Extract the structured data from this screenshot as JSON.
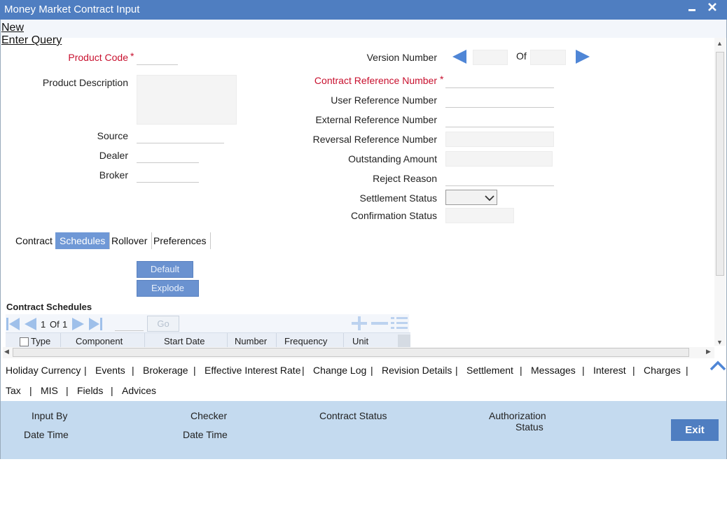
{
  "window": {
    "title": "Money Market Contract Input",
    "minimize_label": "▬",
    "close_label": "✕"
  },
  "toolbar": {
    "new_label": "New",
    "enter_query_label": "Enter Query"
  },
  "form_left": {
    "product_code_label": "Product Code",
    "product_description_label": "Product Description",
    "source_label": "Source",
    "dealer_label": "Dealer",
    "broker_label": "Broker"
  },
  "form_right": {
    "version_number_label": "Version Number",
    "of_label": "Of",
    "contract_reference_label": "Contract Reference Number",
    "user_reference_label": "User Reference Number",
    "external_reference_label": "External Reference Number",
    "reversal_reference_label": "Reversal Reference Number",
    "outstanding_amount_label": "Outstanding Amount",
    "reject_reason_label": "Reject Reason",
    "settlement_status_label": "Settlement Status",
    "confirmation_status_label": "Confirmation Status"
  },
  "required_marker": "*",
  "tabs": [
    {
      "label": "Contract"
    },
    {
      "label": "Schedules"
    },
    {
      "label": "Rollover"
    },
    {
      "label": "Preferences"
    }
  ],
  "schedules": {
    "default_label": "Default",
    "explode_label": "Explode",
    "section_title": "Contract Schedules",
    "page_current": "1",
    "page_of": "Of",
    "page_total": "1",
    "go_label": "Go",
    "columns": [
      "Type",
      "Component",
      "Start Date",
      "Number",
      "Frequency",
      "Unit"
    ]
  },
  "bottom_links_row1": [
    "Holiday Currency",
    "Events",
    "Brokerage",
    "Effective Interest Rate",
    "Change Log",
    "Revision Details",
    "Settlement",
    "Messages",
    "Interest",
    "Charges"
  ],
  "bottom_links_row2": [
    "Tax",
    "MIS",
    "Fields",
    "Advices"
  ],
  "separator": "|",
  "footer": {
    "input_by_label": "Input By",
    "date_time_label": "Date Time",
    "checker_label": "Checker",
    "checker_date_time_label": "Date Time",
    "contract_status_label": "Contract Status",
    "authorization_label": "Authorization",
    "status_label": "Status",
    "exit_label": "Exit"
  },
  "colors": {
    "title_bar": "#4f7ec1",
    "active_tab": "#6f98d6",
    "footer_bg": "#c4daef",
    "required": "#c8102e"
  },
  "icons": [
    "minimize-icon",
    "close-icon",
    "prev-version-arrow-icon",
    "next-version-arrow-icon",
    "first-page-icon",
    "prev-page-icon",
    "next-page-icon",
    "last-page-icon",
    "add-row-icon",
    "delete-row-icon",
    "single-view-icon",
    "collapse-up-icon"
  ]
}
